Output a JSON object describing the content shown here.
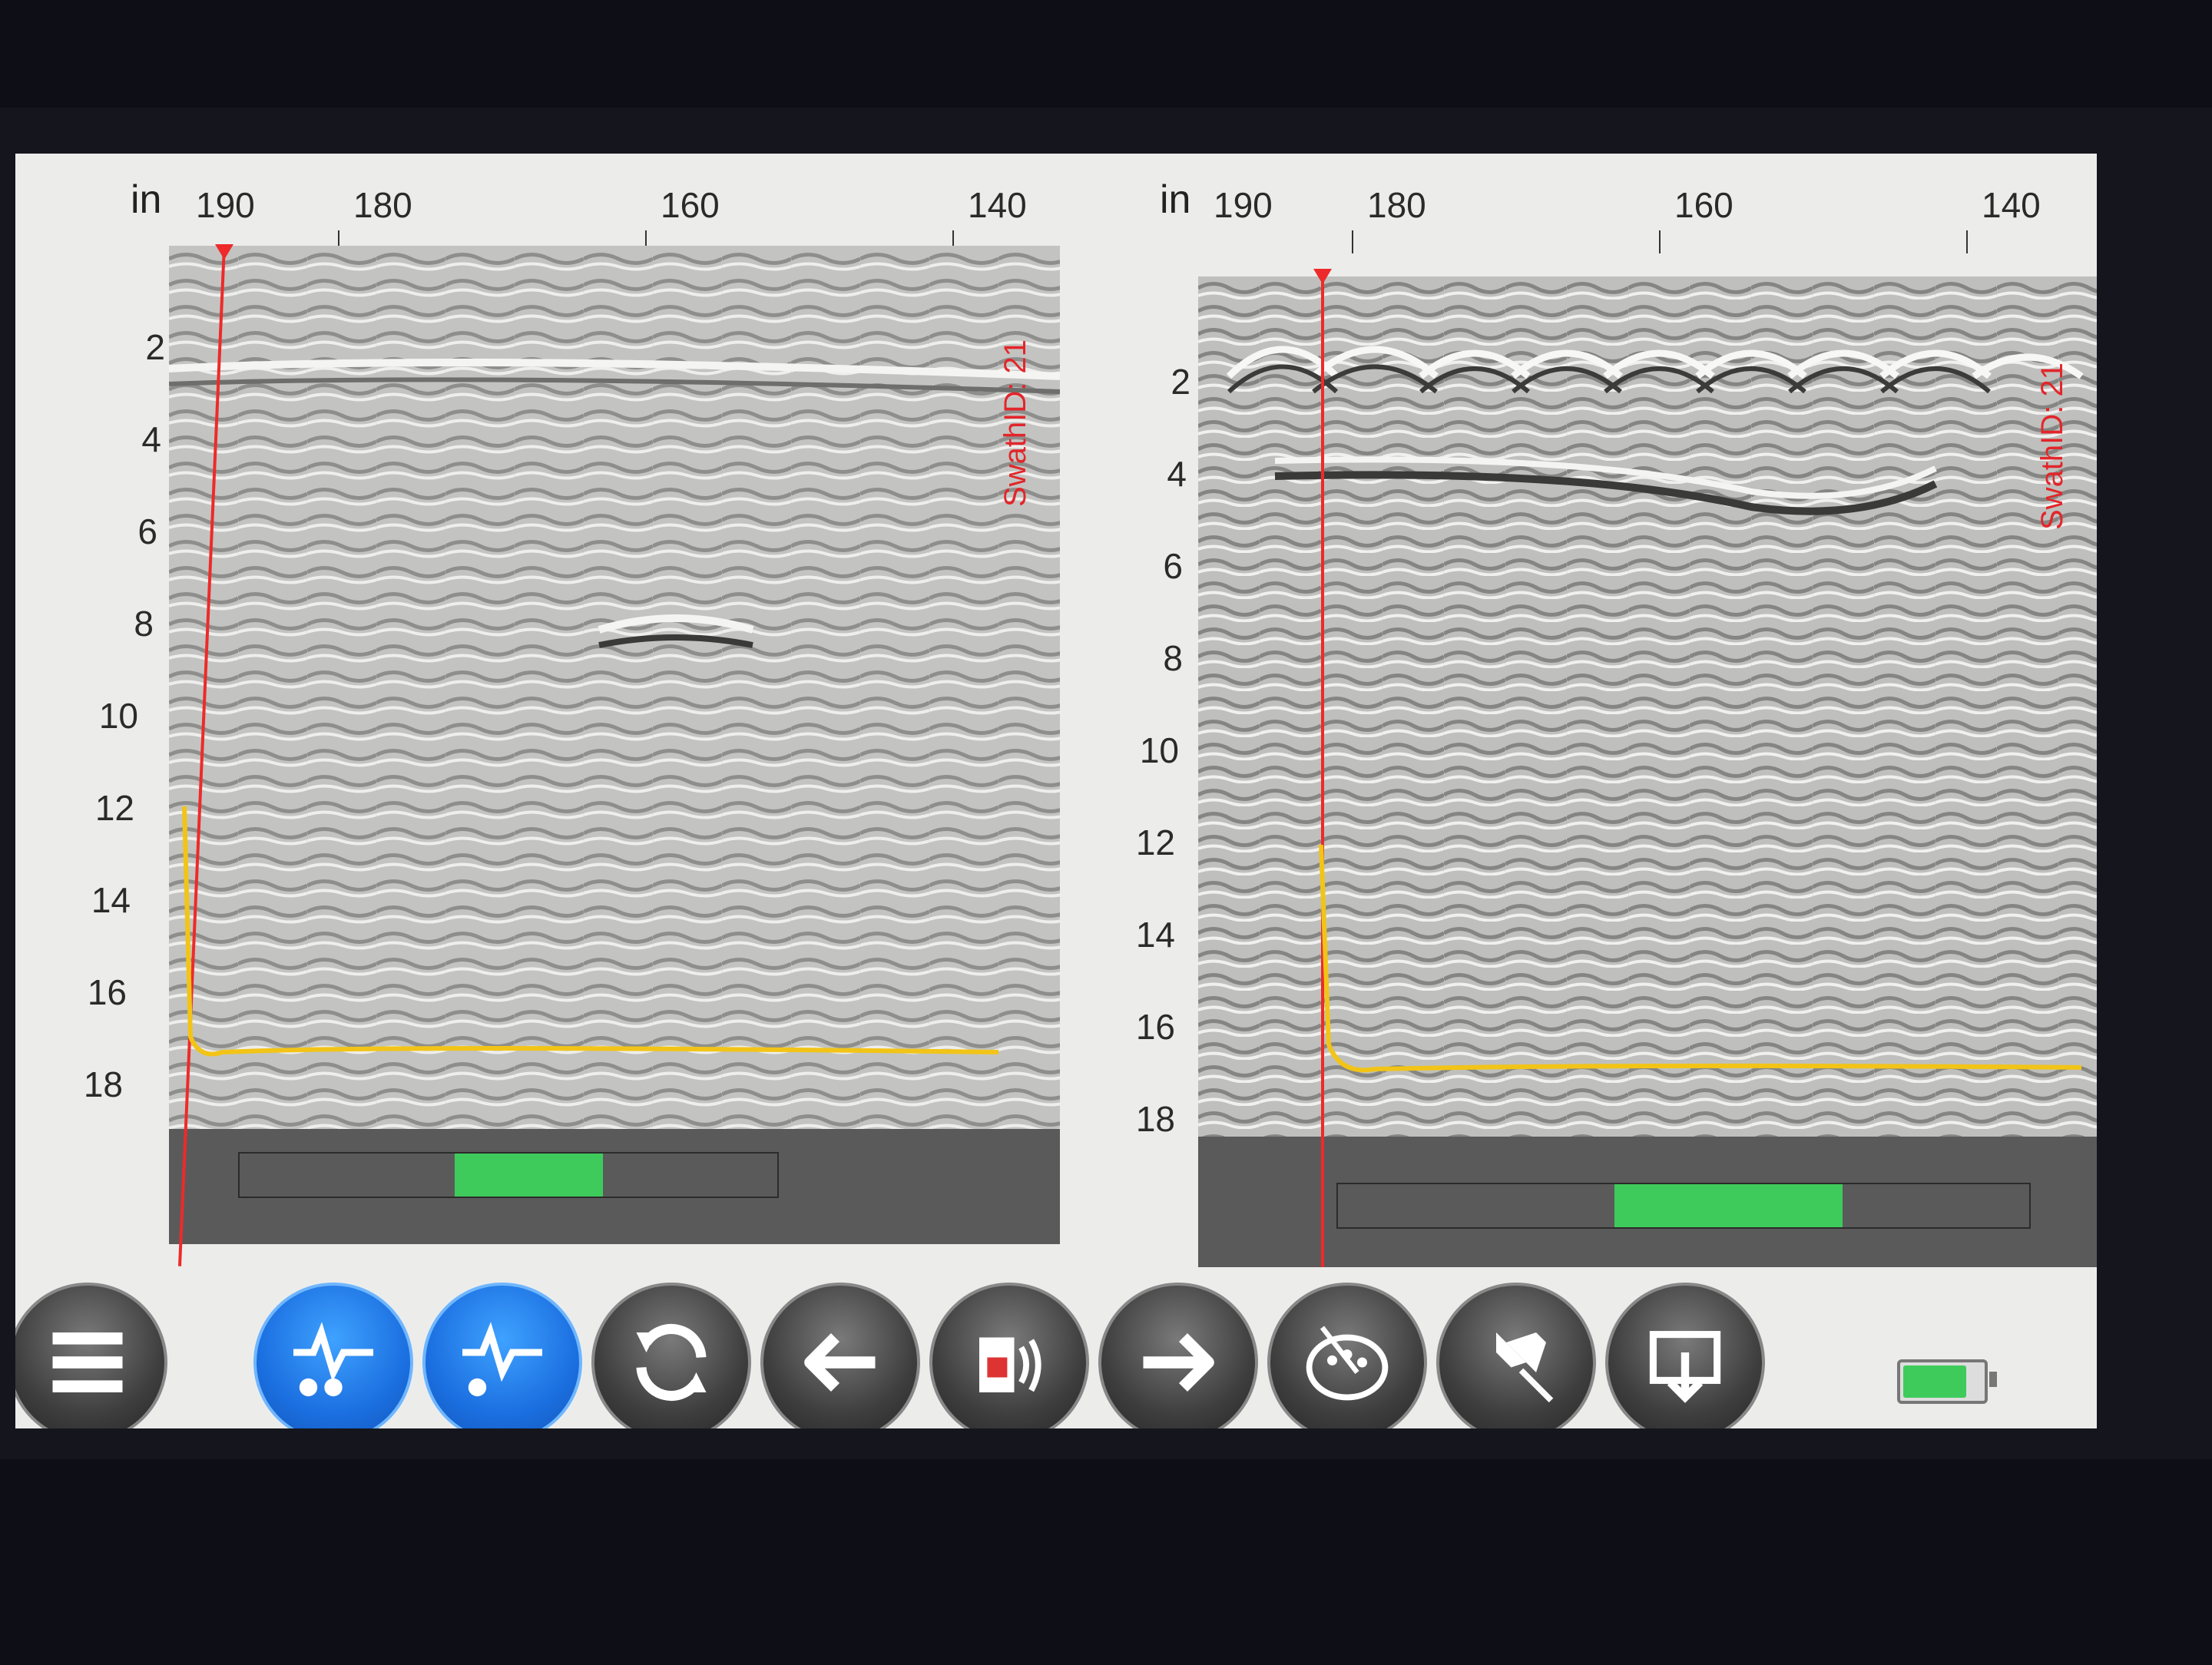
{
  "left_panel": {
    "unit_label": "in",
    "x_ticks": [
      "190",
      "180",
      "160",
      "140"
    ],
    "y_ticks": [
      "2",
      "4",
      "6",
      "8",
      "10",
      "12",
      "14",
      "16",
      "18"
    ],
    "swath_label": "SwathID: 21",
    "signal_level": 0.5
  },
  "right_panel": {
    "unit_label": "in",
    "x_ticks": [
      "190",
      "180",
      "160",
      "140"
    ],
    "y_ticks": [
      "2",
      "4",
      "6",
      "8",
      "10",
      "12",
      "14",
      "16",
      "18"
    ],
    "swath_label": "SwathID: 21",
    "signal_level": 0.6
  },
  "toolbar": {
    "buttons": [
      {
        "name": "menu-icon",
        "active": false
      },
      {
        "name": "signal-view-1-icon",
        "active": true
      },
      {
        "name": "signal-view-2-icon",
        "active": true
      },
      {
        "name": "refresh-icon",
        "active": false
      },
      {
        "name": "arrow-left-icon",
        "active": false
      },
      {
        "name": "audio-report-icon",
        "active": false
      },
      {
        "name": "arrow-right-icon",
        "active": false
      },
      {
        "name": "palette-icon",
        "active": false
      },
      {
        "name": "pin-icon",
        "active": false
      },
      {
        "name": "export-icon",
        "active": false
      }
    ]
  },
  "battery": {
    "level": 0.8
  },
  "colors": {
    "cursor": "#ee2a2a",
    "trace": "#f2c417",
    "progress": "#3ecb5c",
    "active_button": "#1b6fe0"
  }
}
